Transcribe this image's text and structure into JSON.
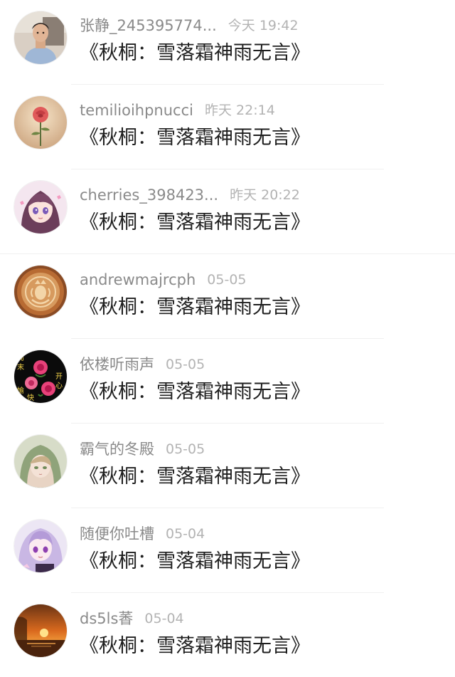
{
  "comments": [
    {
      "username": "张静_245395774...",
      "time": "今天 19:42",
      "content": "《秋桐：雪落霜神雨无言》",
      "avatar_icon": "child-photo-avatar"
    },
    {
      "username": "temilioihpnucci",
      "time": "昨天 22:14",
      "content": "《秋桐：雪落霜神雨无言》",
      "avatar_icon": "rose-avatar"
    },
    {
      "username": "cherries_398423...",
      "time": "昨天 20:22",
      "content": "《秋桐：雪落霜神雨无言》",
      "avatar_icon": "anime-girl-avatar"
    },
    {
      "username": "andrewmajrcph",
      "time": "05-05",
      "content": "《秋桐：雪落霜神雨无言》",
      "avatar_icon": "latte-art-avatar"
    },
    {
      "username": "依楼听雨声",
      "time": "05-05",
      "content": "《秋桐：雪落霜神雨无言》",
      "avatar_icon": "pink-roses-avatar",
      "avatar_text": [
        "周",
        "末",
        "开",
        "心",
        "愉",
        "快"
      ]
    },
    {
      "username": "霸气的冬殿",
      "time": "05-05",
      "content": "《秋桐：雪落霜神雨无言》",
      "avatar_icon": "hooded-girl-avatar"
    },
    {
      "username": "随便你吐槽",
      "time": "05-04",
      "content": "《秋桐：雪落霜神雨无言》",
      "avatar_icon": "purple-anime-avatar"
    },
    {
      "username": "ds5ls萫",
      "time": "05-04",
      "content": "《秋桐：雪落霜神雨无言》",
      "avatar_icon": "sunset-avatar"
    }
  ],
  "colors": {
    "username": "#8a8a8a",
    "time": "#b3b3b3",
    "content": "#1f1f1f",
    "divider": "#f0f0f0"
  }
}
